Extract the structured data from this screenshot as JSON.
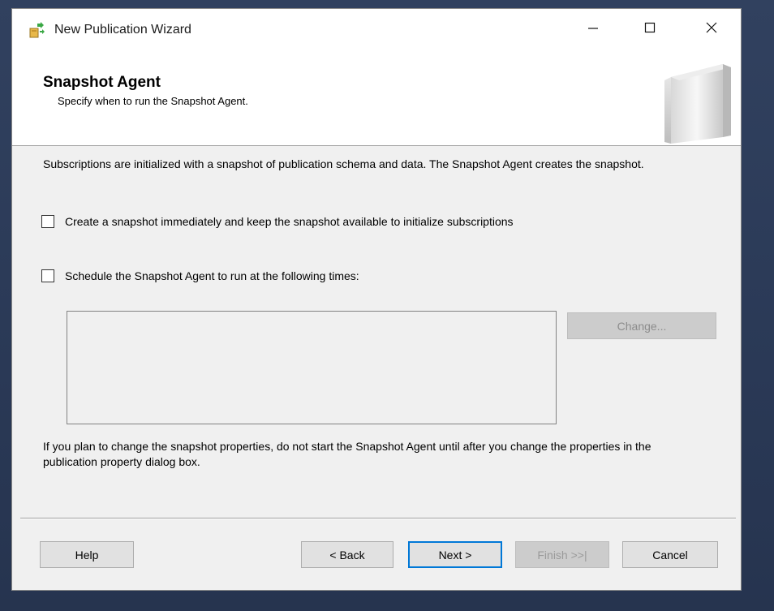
{
  "window": {
    "title": "New Publication Wizard"
  },
  "header": {
    "title": "Snapshot Agent",
    "subtitle": "Specify when to run the Snapshot Agent."
  },
  "content": {
    "intro": "Subscriptions are initialized with a snapshot of publication schema and data. The Snapshot Agent creates the snapshot.",
    "option_immediate": {
      "label": "Create a snapshot immediately and keep the snapshot available to initialize subscriptions",
      "checked": false
    },
    "option_schedule": {
      "label": "Schedule the Snapshot Agent to run at the following times:",
      "checked": false
    },
    "change_label": "Change...",
    "note": "If you plan to change the snapshot properties, do not start the Snapshot Agent until after you change the properties in the publication property dialog box."
  },
  "footer": {
    "help_label": "Help",
    "back_label": "< Back",
    "next_label": "Next >",
    "finish_label": "Finish >>|",
    "cancel_label": "Cancel"
  },
  "icons": {
    "app": "publication-wizard-icon",
    "minimize": "minimize-icon",
    "maximize": "maximize-icon",
    "close": "close-icon",
    "header_graphic": "wizard-banner-graphic"
  },
  "colors": {
    "accent": "#0078d7",
    "dialog_background": "#f0f0f0",
    "disabled_text": "#8c8c8c"
  }
}
